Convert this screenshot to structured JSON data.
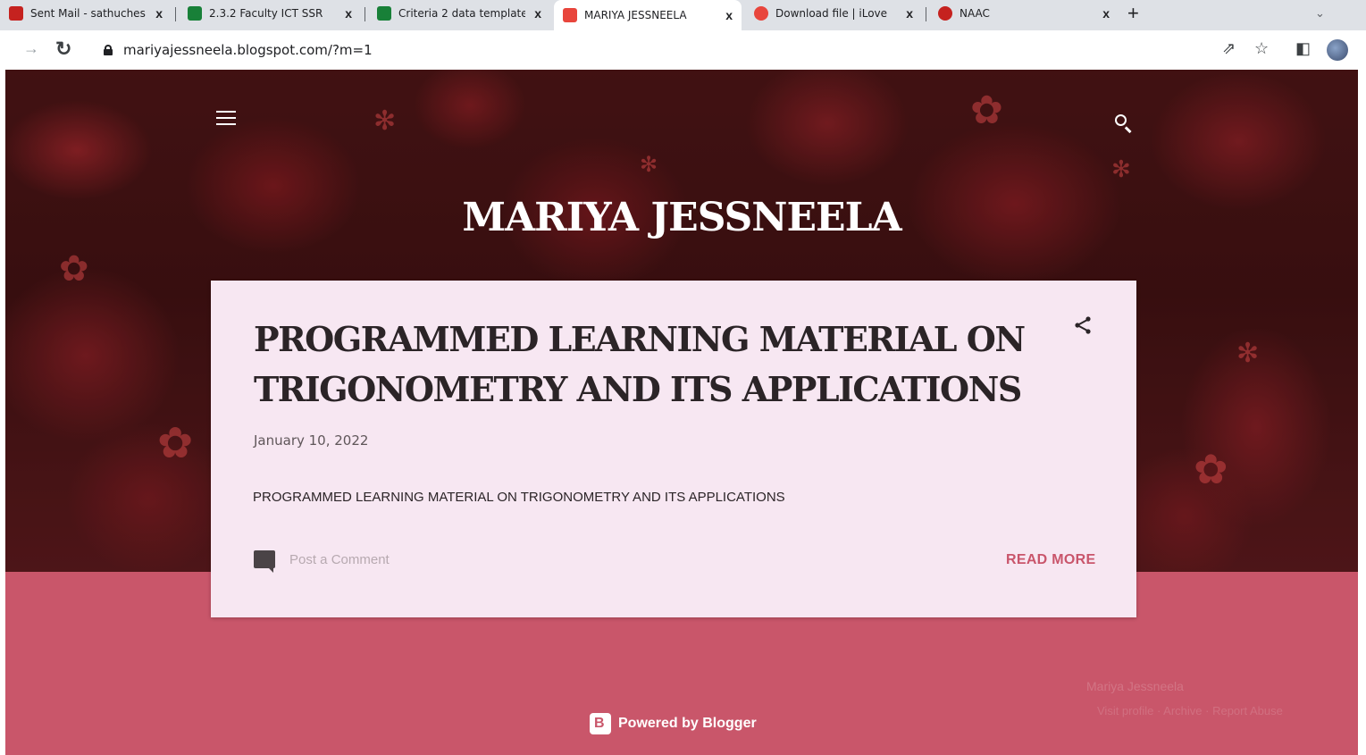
{
  "browser": {
    "tabs": [
      {
        "title": "Sent Mail - sathuches",
        "favicon_color": "#c5221f"
      },
      {
        "title": "2.3.2 Faculty ICT SSR",
        "favicon_color": "#188038"
      },
      {
        "title": "Criteria 2 data template",
        "favicon_color": "#188038"
      },
      {
        "title": "MARIYA JESSNEELA",
        "favicon_color": "#e8453c",
        "active": true
      },
      {
        "title": "Download file | iLove",
        "favicon_color": "#e8453c"
      },
      {
        "title": "NAAC",
        "favicon_color": "#c5221f"
      }
    ],
    "close_glyph": "x",
    "new_tab_glyph": "+",
    "url": "mariyajessneela.blogspot.com/?m=1"
  },
  "blog": {
    "title": "MARIYA JESSNEELA",
    "post": {
      "title": "PROGRAMMED LEARNING MATERIAL ON TRIGONOMETRY AND ITS APPLICATIONS",
      "date": "January 10, 2022",
      "snippet": "PROGRAMMED LEARNING MATERIAL ON TRIGONOMETRY AND ITS APPLICATIONS",
      "comment_label": "Post a Comment",
      "read_more_label": "READ MORE"
    },
    "footer": {
      "powered_label": "Powered by Blogger",
      "faint_line_1": "Mariya Jessneela",
      "faint_line_2": "Visit profile · Archive · Report Abuse"
    }
  },
  "colors": {
    "accent": "#c9556b",
    "card_bg": "#f7e7f2",
    "footer_bg": "#c9566a"
  }
}
